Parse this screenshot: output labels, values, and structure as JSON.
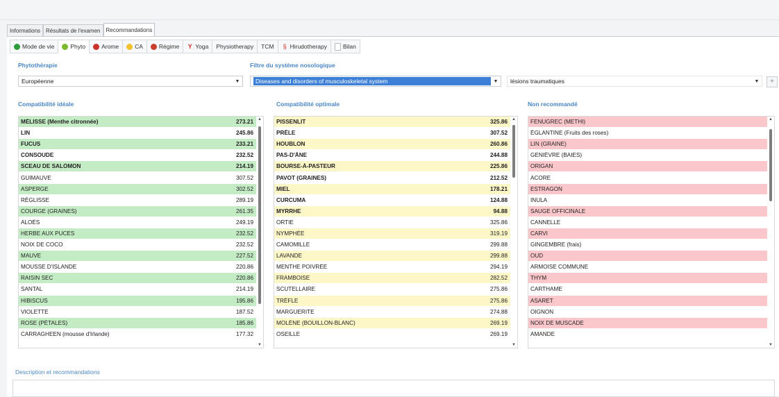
{
  "tabs_top": [
    "Informations",
    "Résultats de l'examen",
    "Recommandations"
  ],
  "tabs_sub": [
    {
      "label": "Mode de vie",
      "icon": "green-circle-icon",
      "color": "#2e9b3c"
    },
    {
      "label": "Phyto",
      "icon": "leaf-icon",
      "color": "#7dbb2e"
    },
    {
      "label": "Arome",
      "icon": "red-drop-icon",
      "color": "#c8322b"
    },
    {
      "label": "CA",
      "icon": "sun-icon",
      "color": "#f2c12e"
    },
    {
      "label": "Régime",
      "icon": "fruit-icon",
      "color": "#c8402b"
    },
    {
      "label": "Yoga",
      "icon": "yoga-icon",
      "color": "#c8322b"
    },
    {
      "label": "Physiotherapy",
      "icon": "",
      "color": ""
    },
    {
      "label": "TCM",
      "icon": "",
      "color": ""
    },
    {
      "label": "Hirudotherapy",
      "icon": "leech-icon",
      "color": "#c8322b"
    },
    {
      "label": "Bilan",
      "icon": "document-icon",
      "color": "#bbbbbb"
    }
  ],
  "filters": {
    "phyto_label": "Phytothérapie",
    "phyto_value": "Européenne",
    "filter_label": "Filtre du système nosologique",
    "filter_value": "Diseases and disorders of musculoskeletal system",
    "third_value": "lésions traumatiques"
  },
  "columns": {
    "ideal_label": "Compatibilité idéale",
    "optimal_label": "Compatibilité optimale",
    "notrec_label": "Non recommandé"
  },
  "colors": {
    "green": "#c4ecc4",
    "yellow": "#fdf6c6",
    "red": "#fbc7cb",
    "white": "#ffffff",
    "accent": "#4a86c5"
  },
  "ideal_rows": [
    {
      "name": "MÉLISSE (Menthe citronnée)",
      "value": "273.21",
      "bold": true,
      "c": "green"
    },
    {
      "name": "LIN",
      "value": "245.86",
      "bold": true,
      "c": "white"
    },
    {
      "name": "FUCUS",
      "value": "233.21",
      "bold": true,
      "c": "green"
    },
    {
      "name": "CONSOUDE",
      "value": "232.52",
      "bold": true,
      "c": "white"
    },
    {
      "name": "SCEAU DE SALOMON",
      "value": "214.19",
      "bold": true,
      "c": "green"
    },
    {
      "name": "GUIMAUVE",
      "value": "307.52",
      "bold": false,
      "c": "white"
    },
    {
      "name": "ASPERGE",
      "value": "302.52",
      "bold": false,
      "c": "green"
    },
    {
      "name": "RÉGLISSE",
      "value": "289.19",
      "bold": false,
      "c": "white"
    },
    {
      "name": "COURGE (GRAINES)",
      "value": "261.35",
      "bold": false,
      "c": "green"
    },
    {
      "name": "ALOÈS",
      "value": "249.19",
      "bold": false,
      "c": "white"
    },
    {
      "name": "HERBE AUX PUCES",
      "value": "232.52",
      "bold": false,
      "c": "green"
    },
    {
      "name": "NOIX DE COCO",
      "value": "232.52",
      "bold": false,
      "c": "white"
    },
    {
      "name": "MAUVE",
      "value": "227.52",
      "bold": false,
      "c": "green"
    },
    {
      "name": "MOUSSE D'ISLANDE",
      "value": "220.86",
      "bold": false,
      "c": "white"
    },
    {
      "name": "RAISIN SEC",
      "value": "220.86",
      "bold": false,
      "c": "green"
    },
    {
      "name": "SANTAL",
      "value": "214.19",
      "bold": false,
      "c": "white"
    },
    {
      "name": "HIBISCUS",
      "value": "195.86",
      "bold": false,
      "c": "green"
    },
    {
      "name": "VIOLETTE",
      "value": "187.52",
      "bold": false,
      "c": "white"
    },
    {
      "name": "ROSE (PÉTALES)",
      "value": "185.86",
      "bold": false,
      "c": "green"
    },
    {
      "name": "CARRAGHEEN (mousse d'Irlande)",
      "value": "177.32",
      "bold": false,
      "c": "white"
    }
  ],
  "optimal_rows": [
    {
      "name": "PISSENLIT",
      "value": "325.86",
      "bold": true,
      "c": "yellow"
    },
    {
      "name": "PRÊLE",
      "value": "307.52",
      "bold": true,
      "c": "white"
    },
    {
      "name": "HOUBLON",
      "value": "260.86",
      "bold": true,
      "c": "yellow"
    },
    {
      "name": "PAS-D'ÂNE",
      "value": "244.88",
      "bold": true,
      "c": "white"
    },
    {
      "name": "BOURSE-À-PASTEUR",
      "value": "225.86",
      "bold": true,
      "c": "yellow"
    },
    {
      "name": "PAVOT (GRAINES)",
      "value": "212.52",
      "bold": true,
      "c": "white"
    },
    {
      "name": "MIEL",
      "value": "178.21",
      "bold": true,
      "c": "yellow"
    },
    {
      "name": "CURCUMA",
      "value": "124.88",
      "bold": true,
      "c": "white"
    },
    {
      "name": "MYRRHE",
      "value": "94.88",
      "bold": true,
      "c": "yellow"
    },
    {
      "name": "ORTIE",
      "value": "325.86",
      "bold": false,
      "c": "white"
    },
    {
      "name": "NYMPHÉE",
      "value": "319.19",
      "bold": false,
      "c": "yellow"
    },
    {
      "name": "CAMOMILLE",
      "value": "299.88",
      "bold": false,
      "c": "white"
    },
    {
      "name": "LAVANDE",
      "value": "299.88",
      "bold": false,
      "c": "yellow"
    },
    {
      "name": "MENTHE POIVRÉE",
      "value": "294.19",
      "bold": false,
      "c": "white"
    },
    {
      "name": "FRAMBOISE",
      "value": "282.52",
      "bold": false,
      "c": "yellow"
    },
    {
      "name": "SCUTELLAIRE",
      "value": "275.86",
      "bold": false,
      "c": "white"
    },
    {
      "name": "TRÈFLE",
      "value": "275.86",
      "bold": false,
      "c": "yellow"
    },
    {
      "name": "MARGUERITE",
      "value": "274.88",
      "bold": false,
      "c": "white"
    },
    {
      "name": "MOLÈNE (BOUILLON-BLANC)",
      "value": "269.19",
      "bold": false,
      "c": "yellow"
    },
    {
      "name": "OSEILLE",
      "value": "269.19",
      "bold": false,
      "c": "white"
    }
  ],
  "notrec_rows": [
    {
      "name": "FENUGREC (METHI)",
      "c": "red"
    },
    {
      "name": "ÉGLANTINE (Fruits des roses)",
      "c": "white"
    },
    {
      "name": "LIN (GRAINE)",
      "c": "red"
    },
    {
      "name": "GENIÈVRE (BAIES)",
      "c": "white"
    },
    {
      "name": "ORIGAN",
      "c": "red"
    },
    {
      "name": "ACORE",
      "c": "white"
    },
    {
      "name": "ESTRAGON",
      "c": "red"
    },
    {
      "name": "INULA",
      "c": "white"
    },
    {
      "name": "SAUGE OFFICINALE",
      "c": "red"
    },
    {
      "name": "CANNELLE",
      "c": "white"
    },
    {
      "name": "CARVI",
      "c": "red"
    },
    {
      "name": "GINGEMBRE (frais)",
      "c": "white"
    },
    {
      "name": "OUD",
      "c": "red"
    },
    {
      "name": "ARMOISE COMMUNE",
      "c": "white"
    },
    {
      "name": "THYM",
      "c": "red"
    },
    {
      "name": "CARTHAME",
      "c": "white"
    },
    {
      "name": "ASARET",
      "c": "red"
    },
    {
      "name": "OIGNON",
      "c": "white"
    },
    {
      "name": "NOIX DE MUSCADE",
      "c": "red"
    },
    {
      "name": "AMANDE",
      "c": "white"
    }
  ],
  "description_label": "Description et recommandations"
}
